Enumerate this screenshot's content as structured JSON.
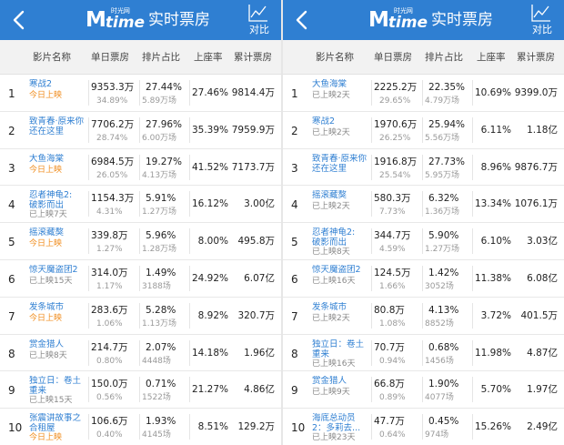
{
  "panels": [
    {
      "header": {
        "title": "实时票房",
        "logo_cn": "时光网",
        "logo_m": "M",
        "logo_time": "time",
        "compare_label": "对比"
      },
      "columns": [
        "影片名称",
        "单日票房",
        "排片占比",
        "上座率",
        "累计票房"
      ],
      "rows": [
        {
          "rank": "1",
          "name_lines": [
            "寒战2"
          ],
          "status": "今日上映",
          "status_type": "today",
          "daily": "9353.3万",
          "daily_pct": "34.89%",
          "share": "27.44%",
          "shows": "5.89万场",
          "occupancy": "27.46%",
          "total": "9814.4万"
        },
        {
          "rank": "2",
          "name_lines": [
            "致青春·原来你",
            "还在这里"
          ],
          "status": "",
          "status_type": "none",
          "daily": "7706.2万",
          "daily_pct": "28.74%",
          "share": "27.96%",
          "shows": "6.00万场",
          "occupancy": "35.39%",
          "total": "7959.9万"
        },
        {
          "rank": "3",
          "name_lines": [
            "大鱼海棠"
          ],
          "status": "今日上映",
          "status_type": "today",
          "daily": "6984.5万",
          "daily_pct": "26.05%",
          "share": "19.27%",
          "shows": "4.13万场",
          "occupancy": "41.52%",
          "total": "7173.7万"
        },
        {
          "rank": "4",
          "name_lines": [
            "忍者神龟2:",
            "破影而出"
          ],
          "status": "已上映7天",
          "status_type": "gray",
          "daily": "1154.3万",
          "daily_pct": "4.31%",
          "share": "5.91%",
          "shows": "1.27万场",
          "occupancy": "16.12%",
          "total": "3.00亿"
        },
        {
          "rank": "5",
          "name_lines": [
            "摇滚藏獒"
          ],
          "status": "今日上映",
          "status_type": "today",
          "daily": "339.8万",
          "daily_pct": "1.27%",
          "share": "5.96%",
          "shows": "1.28万场",
          "occupancy": "8.00%",
          "total": "495.8万"
        },
        {
          "rank": "6",
          "name_lines": [
            "惊天魔盗团2"
          ],
          "status": "已上映15天",
          "status_type": "gray",
          "daily": "314.0万",
          "daily_pct": "1.17%",
          "share": "1.49%",
          "shows": "3188场",
          "occupancy": "24.92%",
          "total": "6.07亿"
        },
        {
          "rank": "7",
          "name_lines": [
            "发条城市"
          ],
          "status": "今日上映",
          "status_type": "today",
          "daily": "283.6万",
          "daily_pct": "1.06%",
          "share": "5.28%",
          "shows": "1.13万场",
          "occupancy": "8.92%",
          "total": "320.7万"
        },
        {
          "rank": "8",
          "name_lines": [
            "赏金猎人"
          ],
          "status": "已上映8天",
          "status_type": "gray",
          "daily": "214.7万",
          "daily_pct": "0.80%",
          "share": "2.07%",
          "shows": "4448场",
          "occupancy": "14.18%",
          "total": "1.96亿"
        },
        {
          "rank": "9",
          "name_lines": [
            "独立日：卷土",
            "重来"
          ],
          "status": "已上映15天",
          "status_type": "gray",
          "daily": "150.0万",
          "daily_pct": "0.56%",
          "share": "0.71%",
          "shows": "1522场",
          "occupancy": "21.27%",
          "total": "4.86亿"
        },
        {
          "rank": "10",
          "name_lines": [
            "张震讲故事之",
            "合租屋"
          ],
          "status": "今日上映",
          "status_type": "today",
          "daily": "106.6万",
          "daily_pct": "0.40%",
          "share": "1.93%",
          "shows": "4145场",
          "occupancy": "8.51%",
          "total": "129.2万"
        }
      ]
    },
    {
      "header": {
        "title": "实时票房",
        "logo_cn": "时光网",
        "logo_m": "M",
        "logo_time": "time",
        "compare_label": "对比"
      },
      "columns": [
        "影片名称",
        "单日票房",
        "排片占比",
        "上座率",
        "累计票房"
      ],
      "rows": [
        {
          "rank": "1",
          "name_lines": [
            "大鱼海棠"
          ],
          "status": "已上映2天",
          "status_type": "gray",
          "daily": "2225.2万",
          "daily_pct": "29.65%",
          "share": "22.35%",
          "shows": "4.79万场",
          "occupancy": "10.69%",
          "total": "9399.0万"
        },
        {
          "rank": "2",
          "name_lines": [
            "寒战2"
          ],
          "status": "已上映2天",
          "status_type": "gray",
          "daily": "1970.6万",
          "daily_pct": "26.25%",
          "share": "25.94%",
          "shows": "5.56万场",
          "occupancy": "6.11%",
          "total": "1.18亿"
        },
        {
          "rank": "3",
          "name_lines": [
            "致青春·原来你",
            "还在这里"
          ],
          "status": "",
          "status_type": "none",
          "daily": "1916.8万",
          "daily_pct": "25.54%",
          "share": "27.73%",
          "shows": "5.95万场",
          "occupancy": "8.96%",
          "total": "9876.7万"
        },
        {
          "rank": "4",
          "name_lines": [
            "摇滚藏獒"
          ],
          "status": "已上映2天",
          "status_type": "gray",
          "daily": "580.3万",
          "daily_pct": "7.73%",
          "share": "6.32%",
          "shows": "1.36万场",
          "occupancy": "13.34%",
          "total": "1076.1万"
        },
        {
          "rank": "5",
          "name_lines": [
            "忍者神龟2:",
            "破影而出"
          ],
          "status": "已上映8天",
          "status_type": "gray",
          "daily": "344.7万",
          "daily_pct": "4.59%",
          "share": "5.90%",
          "shows": "1.27万场",
          "occupancy": "6.10%",
          "total": "3.03亿"
        },
        {
          "rank": "6",
          "name_lines": [
            "惊天魔盗团2"
          ],
          "status": "已上映16天",
          "status_type": "gray",
          "daily": "124.5万",
          "daily_pct": "1.66%",
          "share": "1.42%",
          "shows": "3052场",
          "occupancy": "11.38%",
          "total": "6.08亿"
        },
        {
          "rank": "7",
          "name_lines": [
            "发条城市"
          ],
          "status": "已上映2天",
          "status_type": "gray",
          "daily": "80.8万",
          "daily_pct": "1.08%",
          "share": "4.13%",
          "shows": "8852场",
          "occupancy": "3.72%",
          "total": "401.5万"
        },
        {
          "rank": "8",
          "name_lines": [
            "独立日：卷土",
            "重来"
          ],
          "status": "已上映16天",
          "status_type": "gray",
          "daily": "70.7万",
          "daily_pct": "0.94%",
          "share": "0.68%",
          "shows": "1456场",
          "occupancy": "11.98%",
          "total": "4.87亿"
        },
        {
          "rank": "9",
          "name_lines": [
            "赏金猎人"
          ],
          "status": "已上映9天",
          "status_type": "gray",
          "daily": "66.8万",
          "daily_pct": "0.89%",
          "share": "1.90%",
          "shows": "4077场",
          "occupancy": "5.70%",
          "total": "1.97亿"
        },
        {
          "rank": "10",
          "name_lines": [
            "海底总动员",
            "2：多莉去..."
          ],
          "status": "已上映23天",
          "status_type": "gray",
          "daily": "47.7万",
          "daily_pct": "0.64%",
          "share": "0.45%",
          "shows": "974场",
          "occupancy": "15.26%",
          "total": "2.49亿"
        }
      ]
    }
  ],
  "colors": {
    "header_blue": "#2f7fd2",
    "link_blue": "#2f7fd2",
    "today_orange": "#f08c1d",
    "subtle_gray": "#999999"
  }
}
